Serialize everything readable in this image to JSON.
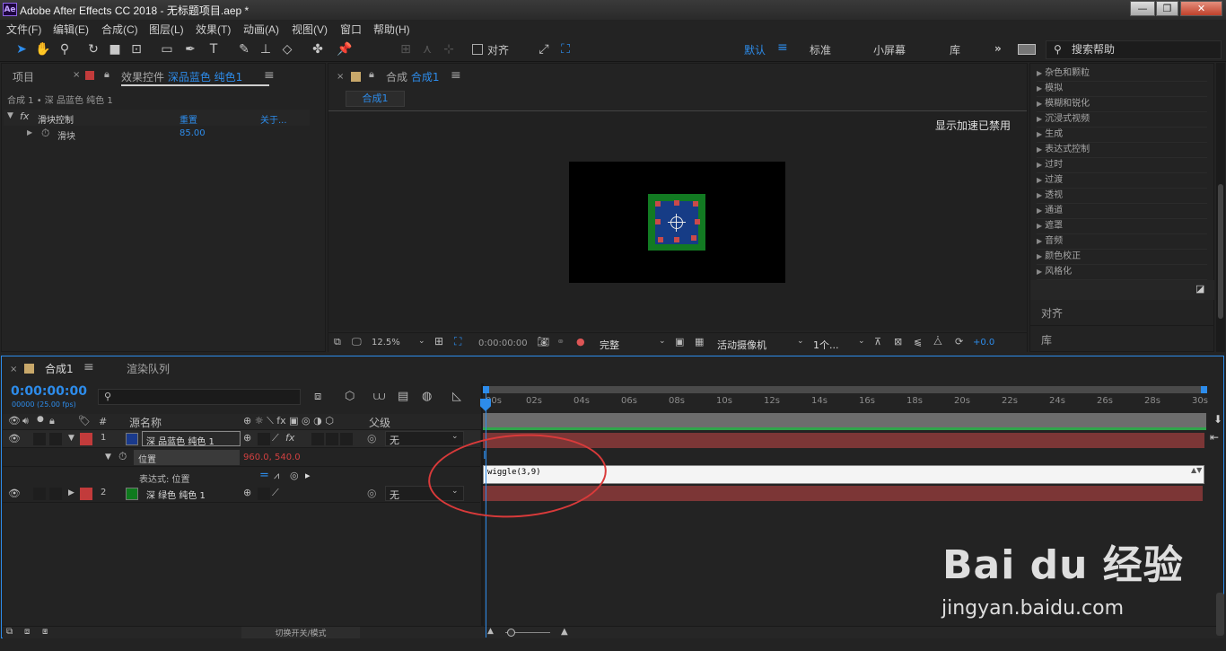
{
  "window": {
    "title": "Adobe After Effects CC 2018 - 无标题项目.aep *",
    "logo": "Ae",
    "buttons": [
      "—",
      "❐",
      "✕"
    ]
  },
  "menu": [
    "文件(F)",
    "编辑(E)",
    "合成(C)",
    "图层(L)",
    "效果(T)",
    "动画(A)",
    "视图(V)",
    "窗口",
    "帮助(H)"
  ],
  "toolbar": {
    "snap_label": "对齐",
    "workspaces": [
      "默认",
      "标准",
      "小屏幕",
      "库"
    ],
    "more": "»",
    "search_placeholder": "搜索帮助"
  },
  "left_panel": {
    "tab_project": "项目",
    "tab_effects_prefix": "效果控件",
    "tab_effects_layer": "深品蓝色 纯色1",
    "breadcrumb": "合成 1 • 深 品蓝色 纯色 1",
    "effect_name": "滑块控制",
    "reset_label": "重置",
    "about_label": "关于...",
    "slider_label": "滑块",
    "slider_value": "85.00"
  },
  "comp_panel": {
    "tab_prefix": "合成",
    "tab_comp": "合成1",
    "subtab": "合成1",
    "accel_notice": "显示加速已禁用",
    "zoom": "12.5%",
    "timecode": "0:00:00:00",
    "quality": "完整",
    "camera": "活动摄像机",
    "views": "1个...",
    "exposure": "+0.0"
  },
  "effects_panel": {
    "items": [
      "杂色和颗粒",
      "模拟",
      "模糊和锐化",
      "沉浸式视频",
      "生成",
      "表达式控制",
      "过时",
      "过渡",
      "透视",
      "通道",
      "遮罩",
      "音频",
      "颜色校正",
      "风格化"
    ],
    "align_label": "对齐",
    "library_label": "库"
  },
  "timeline": {
    "tab_comp": "合成1",
    "tab_render": "渲染队列",
    "timecode": "0:00:00:00",
    "fps_label": "00000 (25.00 fps)",
    "search_placeholder": "",
    "col_hash": "#",
    "col_source": "源名称",
    "col_parent": "父级",
    "layers": [
      {
        "num": "1",
        "name": "深 品蓝色 纯色 1",
        "color": "#1a3a8c",
        "parent": "无",
        "label_color": "#c23b3b"
      },
      {
        "num": "2",
        "name": "深 绿色 纯色 1",
        "color": "#0f7a1e",
        "parent": "无",
        "label_color": "#c23b3b"
      }
    ],
    "prop_position": "位置",
    "prop_position_value": "960.0, 540.0",
    "expr_label": "表达式: 位置",
    "expression": "wiggle(3,9)",
    "ticks": [
      "00s",
      "02s",
      "04s",
      "06s",
      "08s",
      "10s",
      "12s",
      "14s",
      "16s",
      "18s",
      "20s",
      "22s",
      "24s",
      "26s",
      "28s",
      "30s"
    ],
    "footer_toggle": "切换开关/模式",
    "watermark_brand": "Bai du 经验",
    "watermark_url": "jingyan.baidu.com"
  },
  "colors": {
    "accent": "#2d8ceb",
    "bar": "#7c3636",
    "annotation": "#d93a3a"
  }
}
